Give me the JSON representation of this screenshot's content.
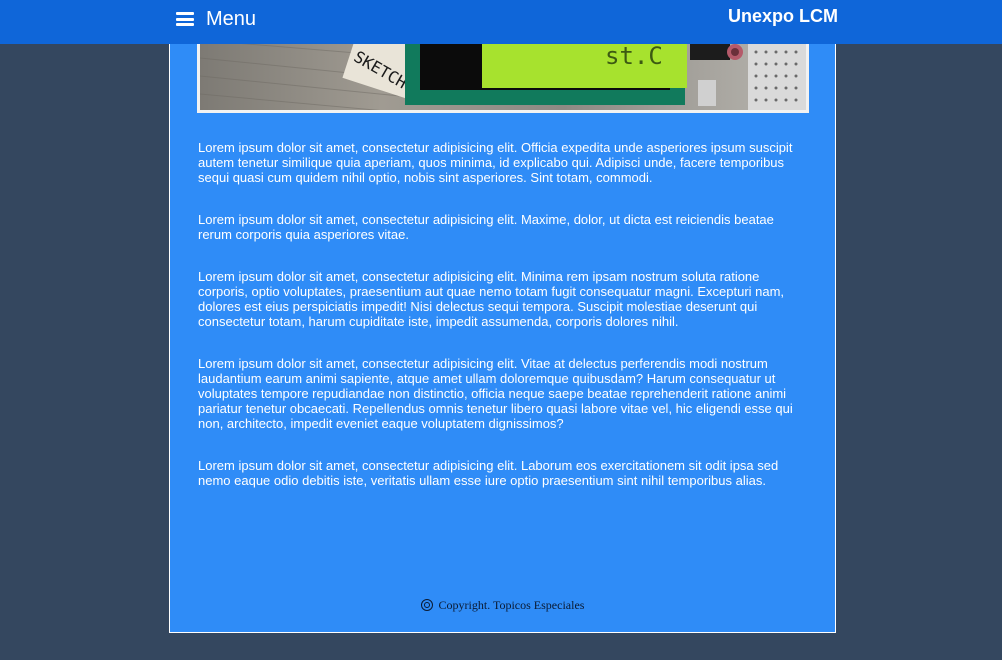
{
  "header": {
    "menu_label": "Menu",
    "brand": "Unexpo LCM",
    "menu_icon": "hamburger-menu-icon"
  },
  "hero": {
    "lcd_text": "st.C",
    "sketch_text": "SKETCH"
  },
  "content": {
    "paragraphs": [
      "Lorem ipsum dolor sit amet, consectetur adipisicing elit. Officia expedita unde asperiores ipsum suscipit autem tenetur similique quia aperiam, quos minima, id explicabo qui. Adipisci unde, facere temporibus sequi quasi cum quidem nihil optio, nobis sint asperiores. Sint totam, commodi.",
      "Lorem ipsum dolor sit amet, consectetur adipisicing elit. Maxime, dolor, ut dicta est reiciendis beatae rerum corporis quia asperiores vitae.",
      "Lorem ipsum dolor sit amet, consectetur adipisicing elit. Minima rem ipsam nostrum soluta ratione corporis, optio voluptates, praesentium aut quae nemo totam fugit consequatur magni. Excepturi nam, dolores est eius perspiciatis impedit! Nisi delectus sequi tempora. Suscipit molestiae deserunt qui consectetur totam, harum cupiditate iste, impedit assumenda, corporis dolores nihil.",
      "Lorem ipsum dolor sit amet, consectetur adipisicing elit. Vitae at delectus perferendis modi nostrum laudantium earum animi sapiente, atque amet ullam doloremque quibusdam? Harum consequatur ut voluptates tempore repudiandae non distinctio, officia neque saepe beatae reprehenderit ratione animi pariatur tenetur obcaecati. Repellendus omnis tenetur libero quasi labore vitae vel, hic eligendi esse qui non, architecto, impedit eveniet eaque voluptatem dignissimos?",
      "Lorem ipsum dolor sit amet, consectetur adipisicing elit. Laborum eos exercitationem sit odit ipsa sed nemo eaque odio debitis iste, veritatis ullam esse iure optio praesentium sint nihil temporibus alias."
    ]
  },
  "footer": {
    "copyright": "Copyright. Topicos Especiales",
    "icon": "copyright-icon"
  },
  "colors": {
    "topbar": "#0f66d9",
    "panel": "#2f8cf7",
    "page_background": "#34475f"
  }
}
